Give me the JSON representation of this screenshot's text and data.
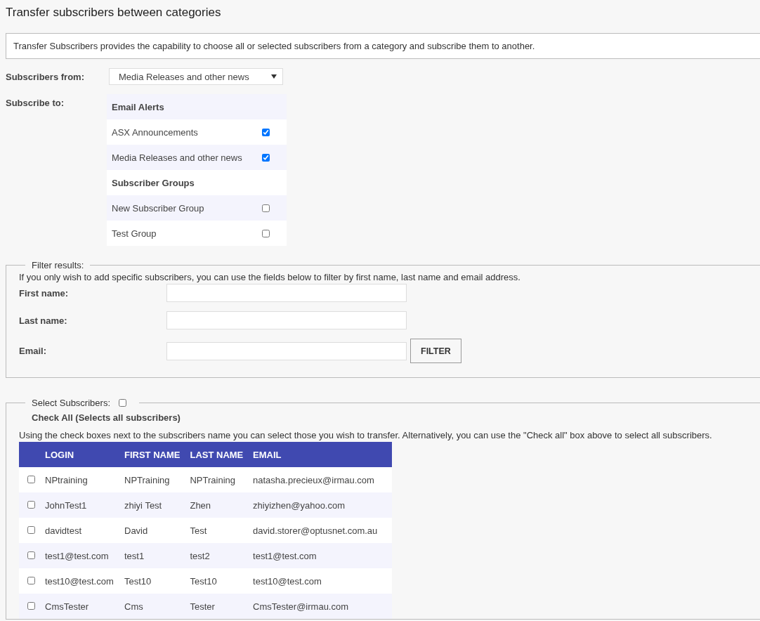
{
  "title": "Transfer subscribers between categories",
  "intro": "Transfer Subscribers provides the capability to choose all or selected subscribers from a category and subscribe them to another.",
  "subscribers_from": {
    "label": "Subscribers from:",
    "value": "Media Releases and other news"
  },
  "subscribe_to": {
    "label": "Subscribe to:",
    "groups": [
      {
        "heading": "Email Alerts",
        "items": [
          {
            "label": "ASX Announcements",
            "checked": true
          },
          {
            "label": "Media Releases and other news",
            "checked": true
          }
        ]
      },
      {
        "heading": "Subscriber Groups",
        "items": [
          {
            "label": "New Subscriber Group",
            "checked": false
          },
          {
            "label": "Test Group",
            "checked": false
          }
        ]
      }
    ]
  },
  "filter": {
    "legend": "Filter results:",
    "hint": "If you only wish to add specific subscribers, you can use the fields below to filter by first name, last name and email address.",
    "fields": [
      {
        "label": "First name:"
      },
      {
        "label": "Last name:"
      },
      {
        "label": "Email:"
      }
    ],
    "button": "FILTER"
  },
  "select": {
    "legend": "Select Subscribers:",
    "checked": false,
    "check_all": "Check All (Selects all subscribers)",
    "hint": "Using the check boxes next to the subscribers name you can select those you wish to transfer. Alternatively, you can use the \"Check all\" box above to select all subscribers.",
    "columns": [
      "LOGIN",
      "FIRST NAME",
      "LAST NAME",
      "EMAIL"
    ],
    "rows": [
      {
        "checked": false,
        "cells": [
          "NPtraining",
          "NPTraining",
          "NPTraining",
          "natasha.precieux@irmau.com"
        ]
      },
      {
        "checked": false,
        "cells": [
          "JohnTest1",
          "zhiyi Test",
          "Zhen",
          "zhiyizhen@yahoo.com"
        ]
      },
      {
        "checked": false,
        "cells": [
          "davidtest",
          "David",
          "Test",
          "david.storer@optusnet.com.au"
        ]
      },
      {
        "checked": false,
        "cells": [
          "test1@test.com",
          "test1",
          "test2",
          "test1@test.com"
        ]
      },
      {
        "checked": false,
        "cells": [
          "test10@test.com",
          "Test10",
          "Test10",
          "test10@test.com"
        ]
      },
      {
        "checked": false,
        "cells": [
          "CmsTester",
          "Cms",
          "Tester",
          "CmsTester@irmau.com"
        ]
      }
    ]
  }
}
